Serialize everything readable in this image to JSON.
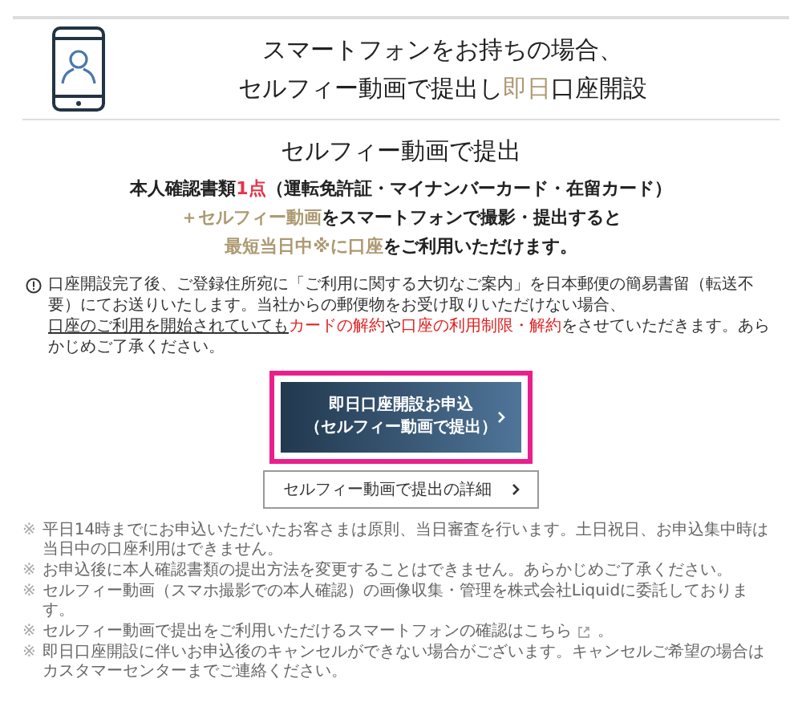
{
  "header": {
    "title_lines": [
      [
        {
          "text": "スマートフォンをお持ちの場合、",
          "kind": "plain"
        }
      ],
      [
        {
          "text": "セルフィー動画で提出し",
          "kind": "plain"
        },
        {
          "text": "即日",
          "kind": "gold"
        },
        {
          "text": "口座開設",
          "kind": "plain"
        }
      ]
    ]
  },
  "section": {
    "heading": "セルフィー動画で提出",
    "lines": [
      [
        {
          "text": "本人確認書類",
          "kind": "plain"
        },
        {
          "text": "1点",
          "kind": "red"
        },
        {
          "text": "（運転免許証・マイナンバーカード・在留カード）",
          "kind": "plain"
        }
      ],
      [
        {
          "text": "＋セルフィー動画",
          "kind": "gold"
        },
        {
          "text": "をスマートフォンで撮影・提出すると",
          "kind": "plain"
        }
      ],
      [
        {
          "text": "最短当日中※に口座",
          "kind": "gold"
        },
        {
          "text": "をご利用いただけます。",
          "kind": "plain"
        }
      ]
    ]
  },
  "notice": [
    {
      "text": "口座開設完了後、ご登録住所宛に「ご利用に関する大切なご案内」を日本郵便の簡易書留（転送不要）にてお送りいたします。当社からの郵便物をお受け取りいただけない場合、",
      "kind": "text"
    },
    {
      "text": "口座のご利用を開始されていても",
      "kind": "link"
    },
    {
      "text": "カードの解約",
      "kind": "alert"
    },
    {
      "text": "や",
      "kind": "text"
    },
    {
      "text": "口座の利用制限・解約",
      "kind": "alert"
    },
    {
      "text": "をさせていただきます。あらかじめご了承ください。",
      "kind": "text"
    }
  ],
  "primary_button": {
    "lines": [
      "即日口座開設お申込",
      "（セルフィー動画で提出）"
    ],
    "highlighted": true
  },
  "secondary_button": {
    "label": "セルフィー動画で提出の詳細"
  },
  "notes": [
    {
      "mark": "※",
      "text": "平日14時までにお申込いただいたお客さまは原則、当日審査を行います。土日祝日、お申込集中時は当日中の口座利用はできません。",
      "external_link": false
    },
    {
      "mark": "※",
      "text": "お申込後に本人確認書類の提出方法を変更することはできません。あらかじめご了承ください。",
      "external_link": false
    },
    {
      "mark": "※",
      "text": "セルフィー動画（スマホ撮影での本人確認）の画像収集・管理を株式会社Liquidに委託しております。",
      "external_link": false
    },
    {
      "mark": "※",
      "text": "セルフィー動画で提出をご利用いただけるスマートフォンの確認はこちら",
      "external_link": true,
      "end": "。"
    },
    {
      "mark": "※",
      "text": "即日口座開設に伴いお申込後のキャンセルができない場合がございます。キャンセルご希望の場合はカスタマーセンターまでご連絡ください。",
      "external_link": false
    }
  ]
}
